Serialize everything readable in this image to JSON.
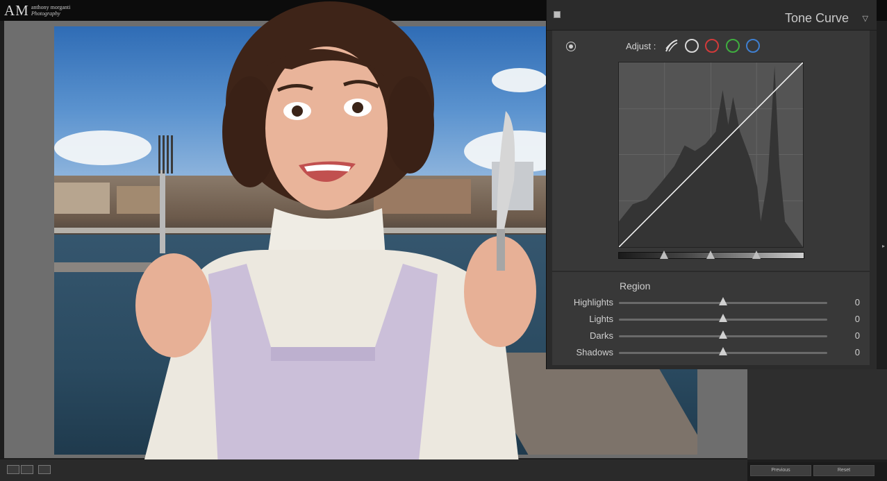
{
  "branding": {
    "mark": "AM",
    "line1": "anthony morganti",
    "line2": "Photography"
  },
  "tone_curve": {
    "title": "Tone Curve",
    "adjust_label": "Adjust :",
    "channel_colors": {
      "rgb": "#cfcfcf",
      "red": "#d23a3a",
      "green": "#3fae3f",
      "blue": "#3f7fd0"
    },
    "region": {
      "title": "Region",
      "items": [
        {
          "label": "Highlights",
          "value": "0"
        },
        {
          "label": "Lights",
          "value": "0"
        },
        {
          "label": "Darks",
          "value": "0"
        },
        {
          "label": "Shadows",
          "value": "0"
        }
      ]
    }
  },
  "buttons": {
    "previous": "Previous",
    "reset": "Reset"
  },
  "icons": [
    "target-adjust-icon",
    "point-curve-icon",
    "panel-collapse-triangle-icon",
    "fork-icon",
    "knife-icon"
  ]
}
